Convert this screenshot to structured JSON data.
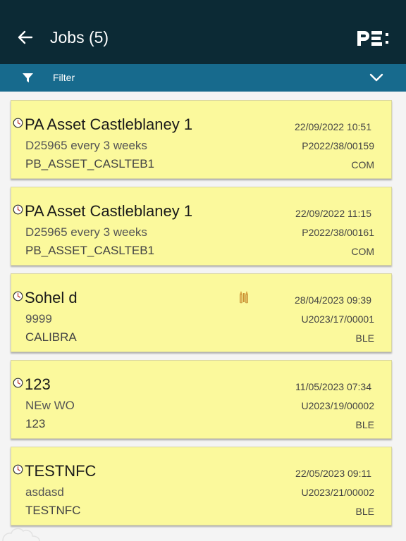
{
  "header": {
    "title": "Jobs (5)",
    "back_icon": "arrow-left-icon",
    "logo_icon": "pe-logo-icon"
  },
  "filter": {
    "label": "Filter",
    "icon": "funnel-icon",
    "toggle_icon": "chevron-down-icon"
  },
  "jobs": [
    {
      "title": "PA Asset Castleblaney 1",
      "description": "D25965 every 3 weeks",
      "asset": "PB_ASSET_CASLTEB1",
      "datetime": "22/09/2022 10:51",
      "reference": "P2022/38/00159",
      "status": "COM"
    },
    {
      "title": "PA Asset Castleblaney 1",
      "description": "D25965 every 3 weeks",
      "asset": "PB_ASSET_CASLTEB1",
      "datetime": "22/09/2022 11:15",
      "reference": "P2022/38/00161",
      "status": "COM"
    },
    {
      "title": "Sohel d",
      "description": "9999",
      "asset": "CALIBRA",
      "datetime": "28/04/2023 09:39",
      "reference": "U2023/17/00001",
      "status": "BLE",
      "extra_icon": "calibration-icon"
    },
    {
      "title": "123",
      "description": "NEw WO",
      "asset": "123",
      "datetime": "11/05/2023 07:34",
      "reference": "U2023/19/00002",
      "status": "BLE"
    },
    {
      "title": "TESTNFC",
      "description": "asdasd",
      "asset": "TESTNFC",
      "datetime": "22/05/2023 09:11",
      "reference": "U2023/21/00002",
      "status": "BLE"
    }
  ],
  "colors": {
    "header_bg": "#0c2a35",
    "filter_bg": "#176a8d",
    "card_bg": "#fbf99c",
    "page_bg": "#f4f4f4",
    "clock_accent": "#c0392b"
  }
}
